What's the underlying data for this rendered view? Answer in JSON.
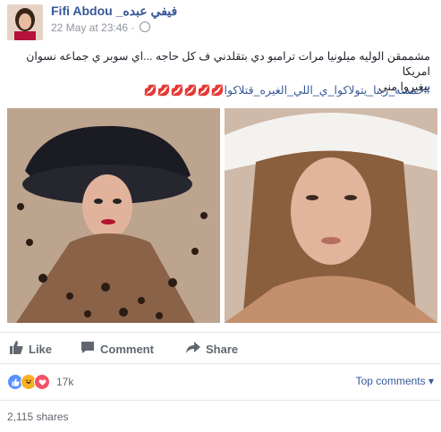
{
  "post": {
    "author_name": "Fifi Abdou",
    "author_name_arabic": "_فيفي عبده",
    "timestamp": "22 May at 23:46 ·",
    "privacy_icon": "globe-icon",
    "text_line1": "مشممقن الوليه ميلونيا مرات ترامبو دي بتقلدني ف كل حاجه ...اي سوبر ي جماعه نسوان امريكا",
    "text_line2": "بيغيروا مني",
    "hashtags": "#حمسه_ربنا_يتولاكوا_ي_اللي_الغيره_قتلاكوا",
    "emoji": "💋💋💋💋💋💋"
  },
  "photos": {
    "left_name": "photo-woman-black-hat-leopard",
    "right_name": "photo-woman-white-hat"
  },
  "actions": {
    "like": "Like",
    "comment": "Comment",
    "share": "Share"
  },
  "reactions": {
    "count": "17k",
    "icons": [
      "like-icon",
      "haha-icon",
      "love-icon"
    ],
    "colors": {
      "like": "#5890ff",
      "haha": "#f7b125",
      "love": "#f25268"
    }
  },
  "top_comments": "Top comments ▾",
  "shares": "2,115 shares"
}
